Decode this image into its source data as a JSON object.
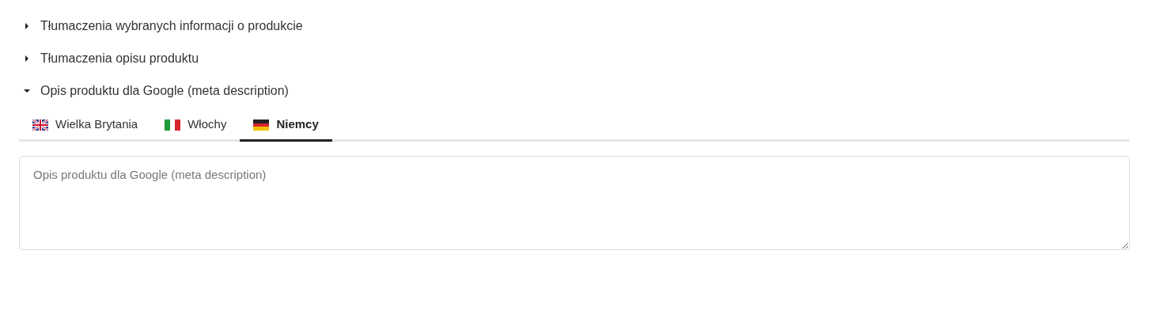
{
  "sections": [
    {
      "title": "Tłumaczenia wybranych informacji o produkcie",
      "expanded": false
    },
    {
      "title": "Tłumaczenia opisu produktu",
      "expanded": false
    },
    {
      "title": "Opis produktu dla Google (meta description)",
      "expanded": true,
      "tabs": [
        {
          "label": "Wielka Brytania",
          "kind": "gb",
          "selected": false
        },
        {
          "label": "Włochy",
          "kind": "it",
          "selected": false
        },
        {
          "label": "Niemcy",
          "kind": "de",
          "selected": true
        }
      ],
      "field": {
        "placeholder": "Opis produktu dla Google (meta description)"
      }
    }
  ]
}
